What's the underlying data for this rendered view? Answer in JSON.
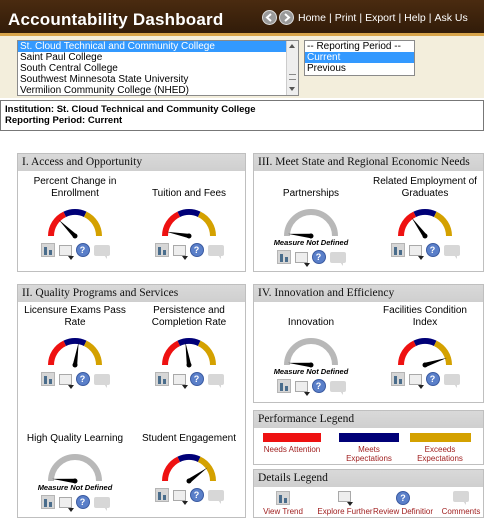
{
  "header": {
    "title": "Accountability Dashboard",
    "nav": [
      "Home",
      "Print",
      "Export",
      "Help",
      "Ask Us"
    ]
  },
  "institutions": {
    "options": [
      "St. Cloud Technical and Community College",
      "Saint Paul College",
      "South Central College",
      "Southwest Minnesota State University",
      "Vermilion Community College (NHED)"
    ],
    "selected_index": 0
  },
  "period": {
    "options": [
      "-- Reporting Period --",
      "Current",
      "Previous"
    ],
    "selected_index": 1
  },
  "info": {
    "institution_line": "Institution: St. Cloud Technical and Community College",
    "period_line": "Reporting Period: Current"
  },
  "sections": [
    {
      "title": "I. Access and Opportunity",
      "gauges": [
        {
          "label": "Percent Change in Enrollment",
          "defined": true,
          "needle": 0.25
        },
        {
          "label": "Tuition and Fees",
          "defined": true,
          "needle": 0.06
        }
      ]
    },
    {
      "title": "III. Meet State and Regional Economic Needs",
      "gauges": [
        {
          "label": "Partnerships",
          "defined": false,
          "needle": 0.03
        },
        {
          "label": "Related Employment of Graduates",
          "defined": true,
          "needle": 0.3
        }
      ]
    },
    {
      "title": "II. Quality Programs and Services",
      "gauges": [
        {
          "label": "Licensure Exams Pass Rate",
          "defined": true,
          "needle": 0.55
        },
        {
          "label": "Persistence and Completion Rate",
          "defined": true,
          "needle": 0.45
        }
      ]
    },
    {
      "title": "IV. Innovation and Efficiency",
      "gauges": [
        {
          "label": "Innovation",
          "defined": false,
          "needle": 0.03
        },
        {
          "label": "Facilities Condition Index",
          "defined": true,
          "needle": 0.9
        }
      ]
    },
    {
      "title": "",
      "gauges": [
        {
          "label": "High Quality Learning",
          "defined": false,
          "needle": 0.03
        },
        {
          "label": "Student Engagement",
          "defined": true,
          "needle": 0.8
        }
      ]
    }
  ],
  "not_defined_text": "Measure Not Defined",
  "performance_legend": {
    "title": "Performance Legend",
    "items": [
      {
        "label": "Needs Attention",
        "color": "#ee1111"
      },
      {
        "label": "Meets Expectations",
        "color": "#000077"
      },
      {
        "label": "Exceeds Expectations",
        "color": "#d4a100"
      }
    ]
  },
  "details_legend": {
    "title": "Details Legend",
    "items": [
      {
        "label": "View Trend",
        "icon": "trend-icon"
      },
      {
        "label": "Explore Further",
        "icon": "explore-icon"
      },
      {
        "label": "Review Definitior",
        "icon": "help-icon"
      },
      {
        "label": "Comments",
        "icon": "comment-icon"
      }
    ]
  }
}
